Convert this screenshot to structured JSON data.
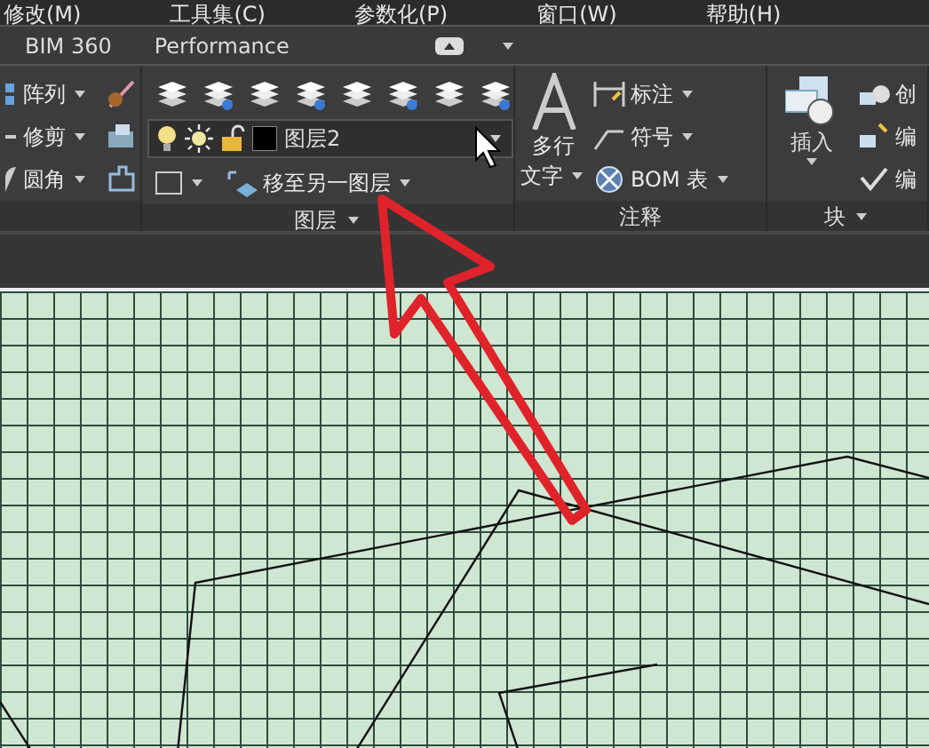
{
  "menu": [
    {
      "label": "修改(M)"
    },
    {
      "label": "工具集(C)"
    },
    {
      "label": "参数化(P)"
    },
    {
      "label": "窗口(W)"
    },
    {
      "label": "帮助(H)"
    }
  ],
  "tabs": [
    {
      "label": "BIM 360",
      "selected": false
    },
    {
      "label": "Performance",
      "selected": false
    }
  ],
  "modify_panel": {
    "items": [
      {
        "label": "阵列"
      },
      {
        "label": "修剪"
      },
      {
        "label": "圆角"
      }
    ]
  },
  "layers_panel": {
    "title": "图层",
    "layer_dropdown": {
      "value": "图层2"
    },
    "move_to_layer": {
      "label": "移至另一图层"
    }
  },
  "annotation_panel": {
    "title": "注释",
    "mtext": {
      "lines": [
        "多行",
        "文字"
      ]
    },
    "items": [
      {
        "label": "标注"
      },
      {
        "label": "符号"
      },
      {
        "label": "BOM 表"
      }
    ]
  },
  "block_panel": {
    "title": "块",
    "insert": {
      "label": "插入"
    },
    "items": [
      {
        "label": "创"
      },
      {
        "label": "编"
      },
      {
        "label": "编"
      }
    ]
  }
}
